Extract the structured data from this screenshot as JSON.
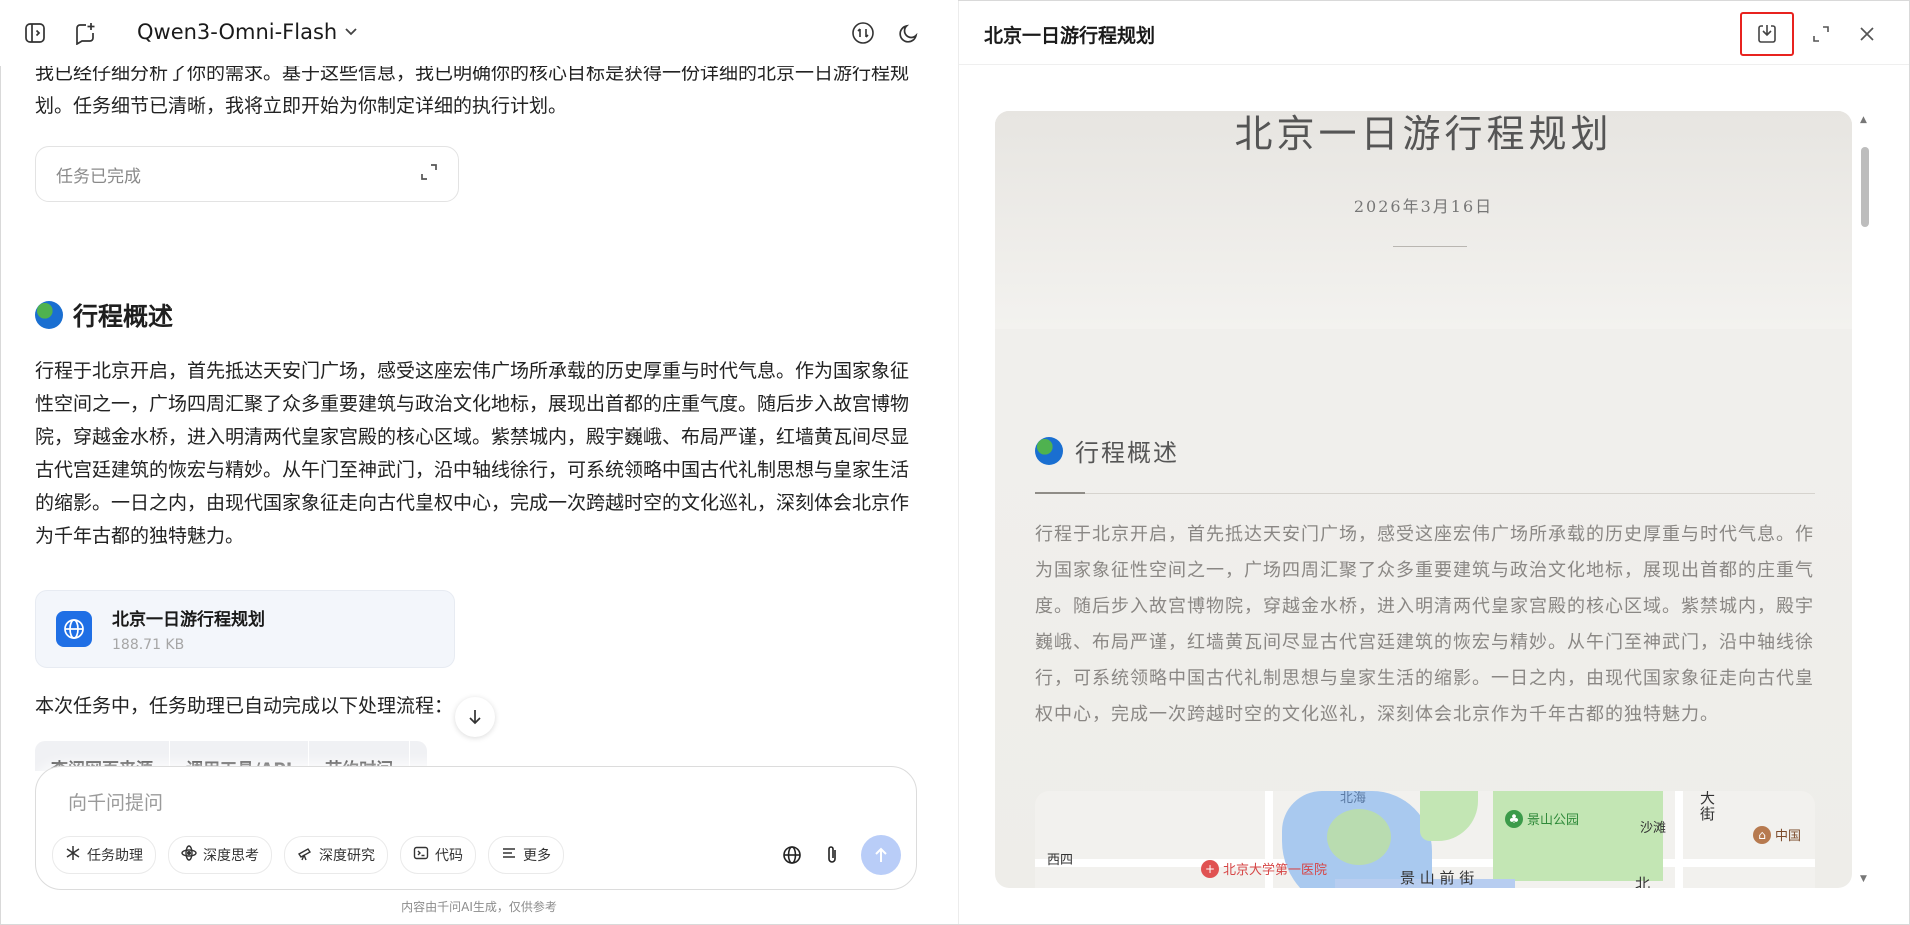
{
  "left": {
    "model_name": "Qwen3-Omni-Flash",
    "intro_text": "我已经仔细分析了你的需求。基于这些信息，我已明确你的核心目标是获得一份详细的北京一日游行程规划。任务细节已清晰，我将立即开始为你制定详细的执行计划。",
    "task_status": "任务已完成",
    "section_heading": "行程概述",
    "overview": "行程于北京开启，首先抵达天安门广场，感受这座宏伟广场所承载的历史厚重与时代气息。作为国家象征性空间之一，广场四周汇聚了众多重要建筑与政治文化地标，展现出首都的庄重气度。随后步入故宫博物院，穿越金水桥，进入明清两代皇家宫殿的核心区域。紫禁城内，殿宇巍峨、布局严谨，红墙黄瓦间尽显古代宫廷建筑的恢宏与精妙。从午门至神武门，沿中轴线徐行，可系统领略中国古代礼制思想与皇家生活的缩影。一日之内，由现代国家象征走向古代皇权中心，完成一次跨越时空的文化巡礼，深刻体会北京作为千年古都的独特魅力。",
    "file": {
      "name": "北京一日游行程规划",
      "size": "188.71 KB"
    },
    "process_text": "本次任务中，任务助理已自动完成以下处理流程：",
    "table_headers": [
      "查阅网页来源",
      "调用工具/API",
      "节约时间"
    ],
    "composer": {
      "placeholder": "向千问提问",
      "tools": [
        "任务助理",
        "深度思考",
        "深度研究",
        "代码",
        "更多"
      ]
    },
    "disclaimer": "内容由千问AI生成，仅供参考"
  },
  "right": {
    "title": "北京一日游行程规划",
    "doc": {
      "title": "北京一日游行程规划",
      "date": "2026年3月16日",
      "section_heading": "行程概述",
      "body": "行程于北京开启，首先抵达天安门广场，感受这座宏伟广场所承载的历史厚重与时代气息。作为国家象征性空间之一，广场四周汇聚了众多重要建筑与政治文化地标，展现出首都的庄重气度。随后步入故宫博物院，穿越金水桥，进入明清两代皇家宫殿的核心区域。紫禁城内，殿宇巍峨、布局严谨，红墙黄瓦间尽显古代宫廷建筑的恢宏与精妙。从午门至神武门，沿中轴线徐行，可系统领略中国古代礼制思想与皇家生活的缩影。一日之内，由现代国家象征走向古代皇权中心，完成一次跨越时空的文化巡礼，深刻体会北京作为千年古都的独特魅力。",
      "map_labels": {
        "beihai": "北海",
        "jingshan": "景山公园",
        "shatan": "沙滩",
        "xisi": "西四",
        "hospital": "北京大学第一医院",
        "jingshan_front": "景 山 前 街",
        "bei": "北",
        "da": "大",
        "jie": "街",
        "museum": "中国"
      }
    }
  }
}
